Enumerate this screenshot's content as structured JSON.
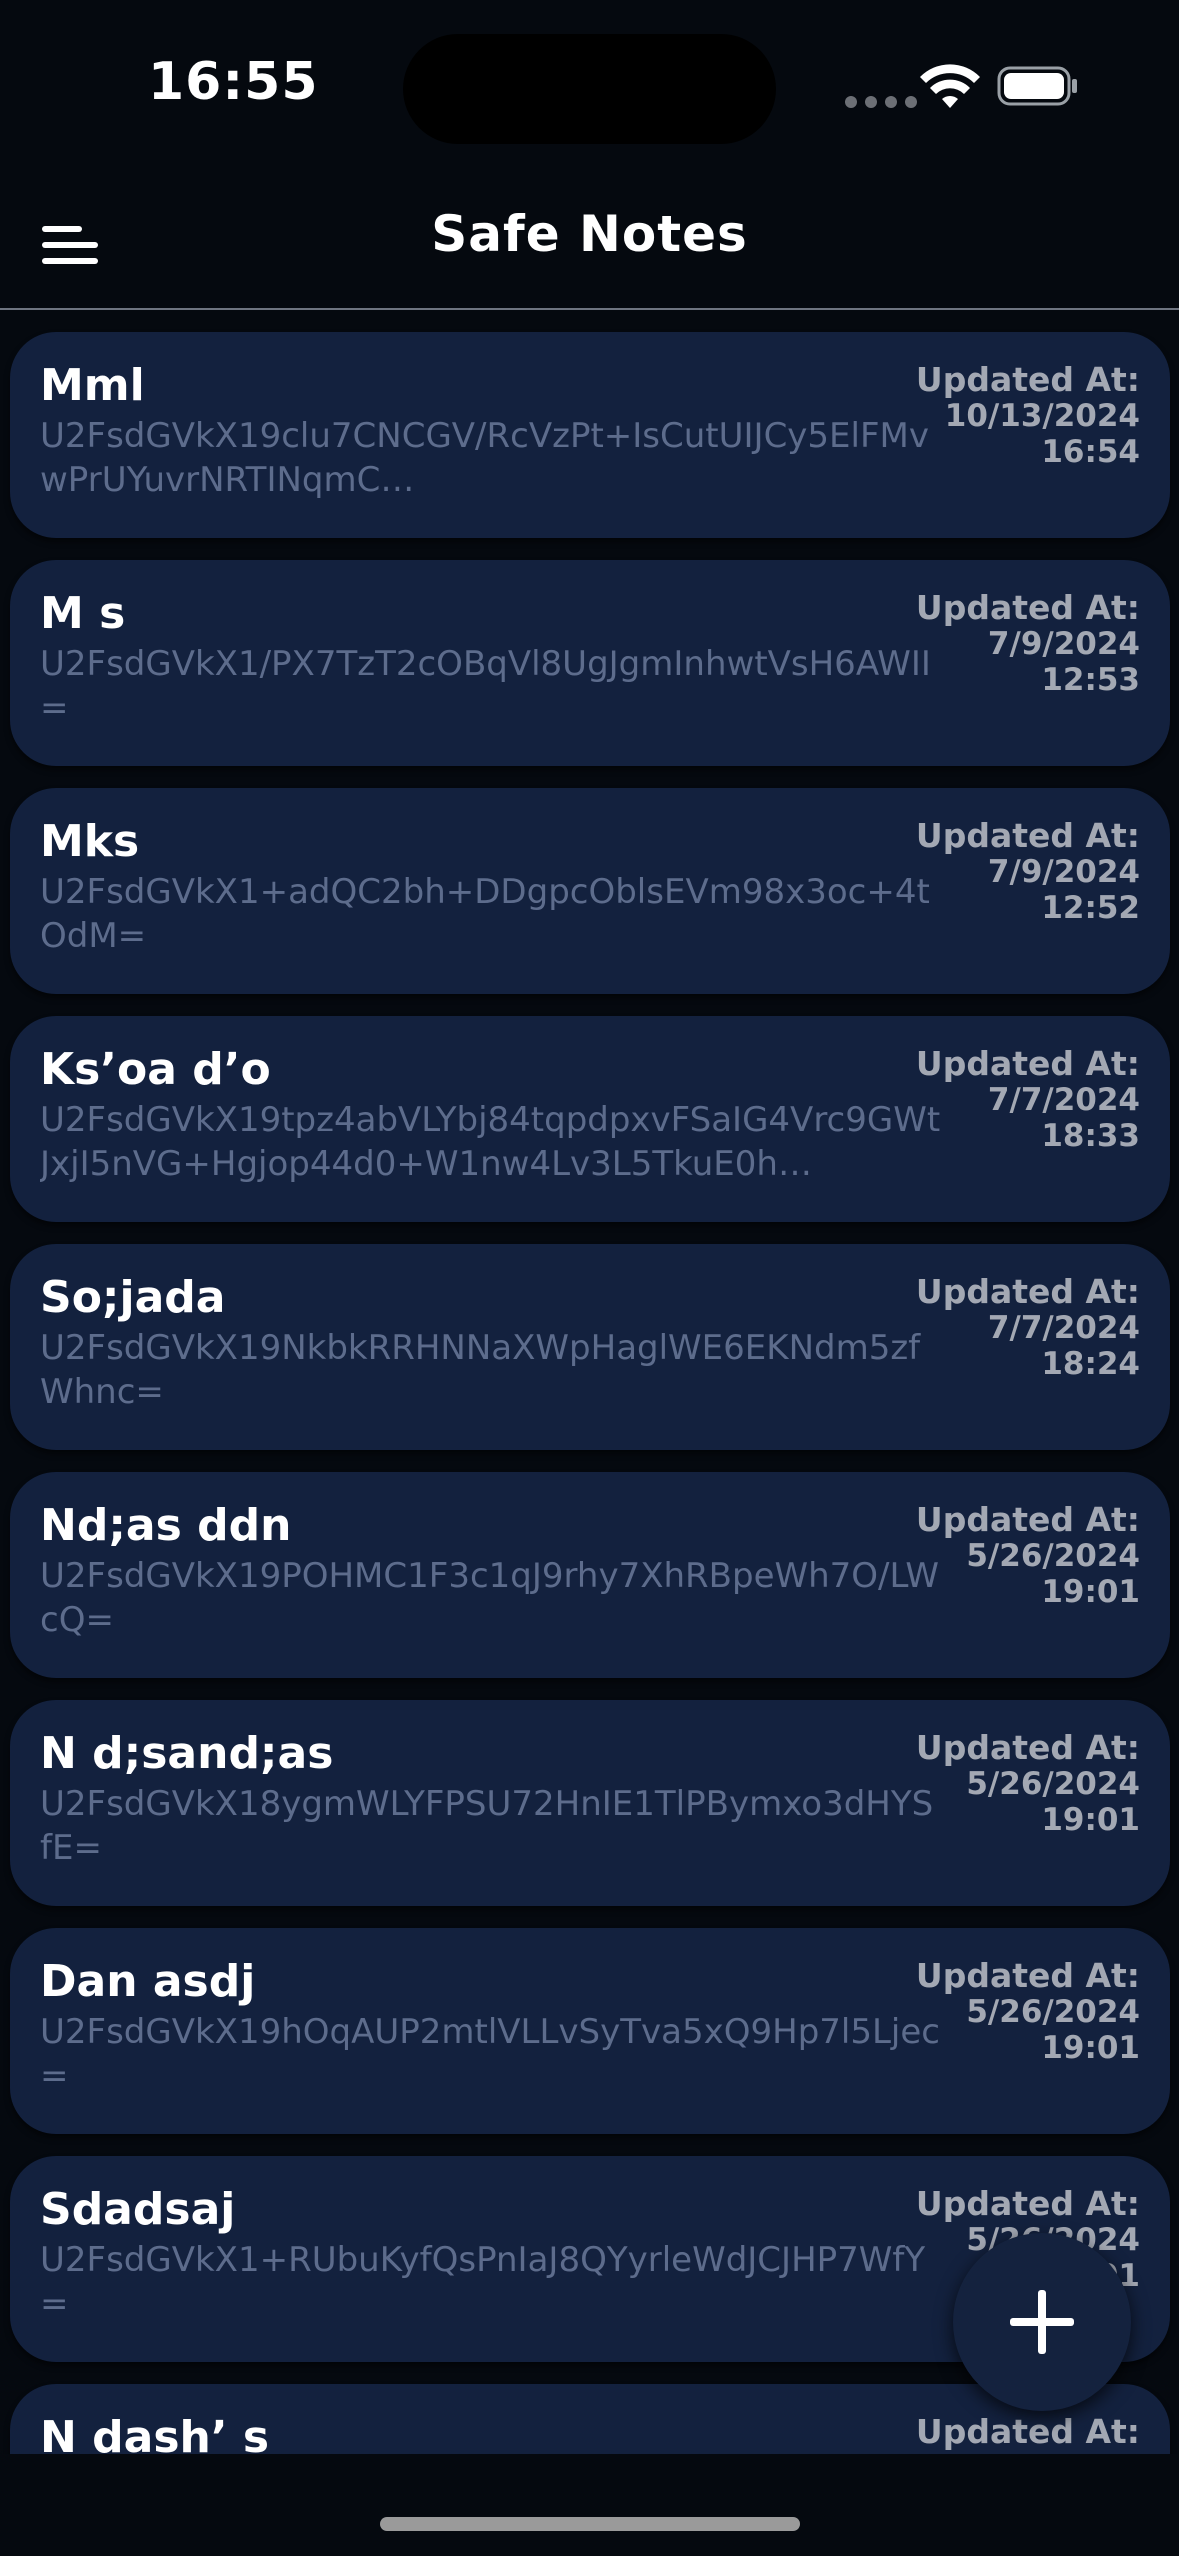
{
  "status_bar": {
    "time": "16:55"
  },
  "header": {
    "title": "Safe Notes"
  },
  "notes": [
    {
      "title": "Mml",
      "body": "U2FsdGVkX19clu7CNCGV/RcVzPt+IsCutUIJCy5ElFMvwPrUYuvrNRTINqmC…",
      "updated_label": "Updated At:",
      "date": "10/13/2024",
      "time": "16:54"
    },
    {
      "title": "M s",
      "body": "U2FsdGVkX1/PX7TzT2cOBqVl8UgJgmInhwtVsH6AWII=",
      "updated_label": "Updated At:",
      "date": "7/9/2024",
      "time": "12:53"
    },
    {
      "title": "Mks",
      "body": "U2FsdGVkX1+adQC2bh+DDgpcOblsEVm98x3oc+4tOdM=",
      "updated_label": "Updated At:",
      "date": "7/9/2024",
      "time": "12:52"
    },
    {
      "title": "Ks’oa d’o",
      "body": "U2FsdGVkX19tpz4abVLYbj84tqpdpxvFSaIG4Vrc9GWtJxjI5nVG+Hgjop44d0+W1nw4Lv3L5TkuE0h…",
      "updated_label": "Updated At:",
      "date": "7/7/2024",
      "time": "18:33"
    },
    {
      "title": "So;jada",
      "body": "U2FsdGVkX19NkbkRRHNNaXWpHaglWE6EKNdm5zfWhnc=",
      "updated_label": "Updated At:",
      "date": "7/7/2024",
      "time": "18:24"
    },
    {
      "title": "Nd;as ddn",
      "body": "U2FsdGVkX19POHMC1F3c1qJ9rhy7XhRBpeWh7O/LWcQ=",
      "updated_label": "Updated At:",
      "date": "5/26/2024",
      "time": "19:01"
    },
    {
      "title": "N d;sand;as",
      "body": "U2FsdGVkX18ygmWLYFPSU72HnIE1TlPBymxo3dHYSfE=",
      "updated_label": "Updated At:",
      "date": "5/26/2024",
      "time": "19:01"
    },
    {
      "title": "Dan asdj",
      "body": "U2FsdGVkX19hOqAUP2mtlVLLvSyTva5xQ9Hp7l5Ljec=",
      "updated_label": "Updated At:",
      "date": "5/26/2024",
      "time": "19:01"
    },
    {
      "title": "Sdadsaj",
      "body": "U2FsdGVkX1+RUbuKyfQsPnIaJ8QYyrleWdJCJHP7WfY=",
      "updated_label": "Updated At:",
      "date": "5/26/2024",
      "time": "19:01"
    },
    {
      "title": "N dash’ s",
      "body": "",
      "updated_label": "Updated At:",
      "date": "",
      "time": ""
    }
  ],
  "colors": {
    "background": "#05090f",
    "card": "#13213e",
    "body_text": "#5d6c8c",
    "meta_text": "#a3a8b3"
  },
  "icons": {
    "menu": "hamburger-menu-icon",
    "add": "plus-icon",
    "wifi": "wifi-icon",
    "battery": "battery-icon"
  }
}
